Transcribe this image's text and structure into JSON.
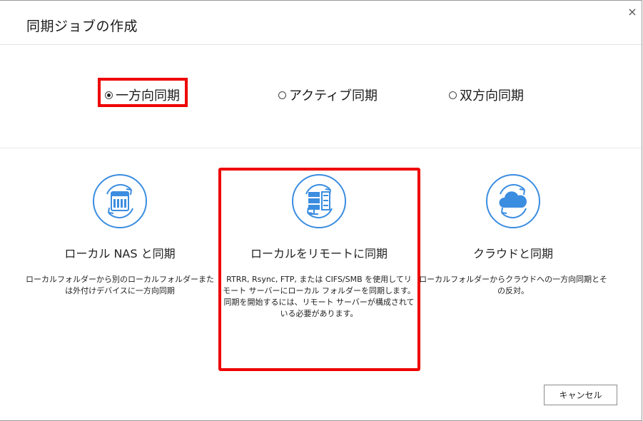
{
  "dialog": {
    "title": "同期ジョブの作成",
    "close_glyph": "×"
  },
  "sync_modes": [
    {
      "label": "一方向同期",
      "selected": true
    },
    {
      "label": "アクティブ同期",
      "selected": false
    },
    {
      "label": "双方向同期",
      "selected": false
    }
  ],
  "cards": [
    {
      "icon": "nas-sync-icon",
      "title": "ローカル NAS と同期",
      "description": "ローカルフォルダーから別のローカルフォルダーまたは外付けデバイスに一方向同期"
    },
    {
      "icon": "server-sync-icon",
      "title": "ローカルをリモートに同期",
      "description": "RTRR, Rsync, FTP, または CIFS/SMB を使用してリモート サーバーにローカル フォルダーを同期します。",
      "description2": "同期を開始するには、リモート サーバーが構成されている必要があります。"
    },
    {
      "icon": "cloud-sync-icon",
      "title": "クラウドと同期",
      "description": "ローカルフォルダーからクラウドへの一方向同期とその反対。"
    }
  ],
  "footer": {
    "cancel_label": "キャンセル"
  },
  "colors": {
    "accent": "#3b8de0",
    "highlight": "#ee0000"
  }
}
